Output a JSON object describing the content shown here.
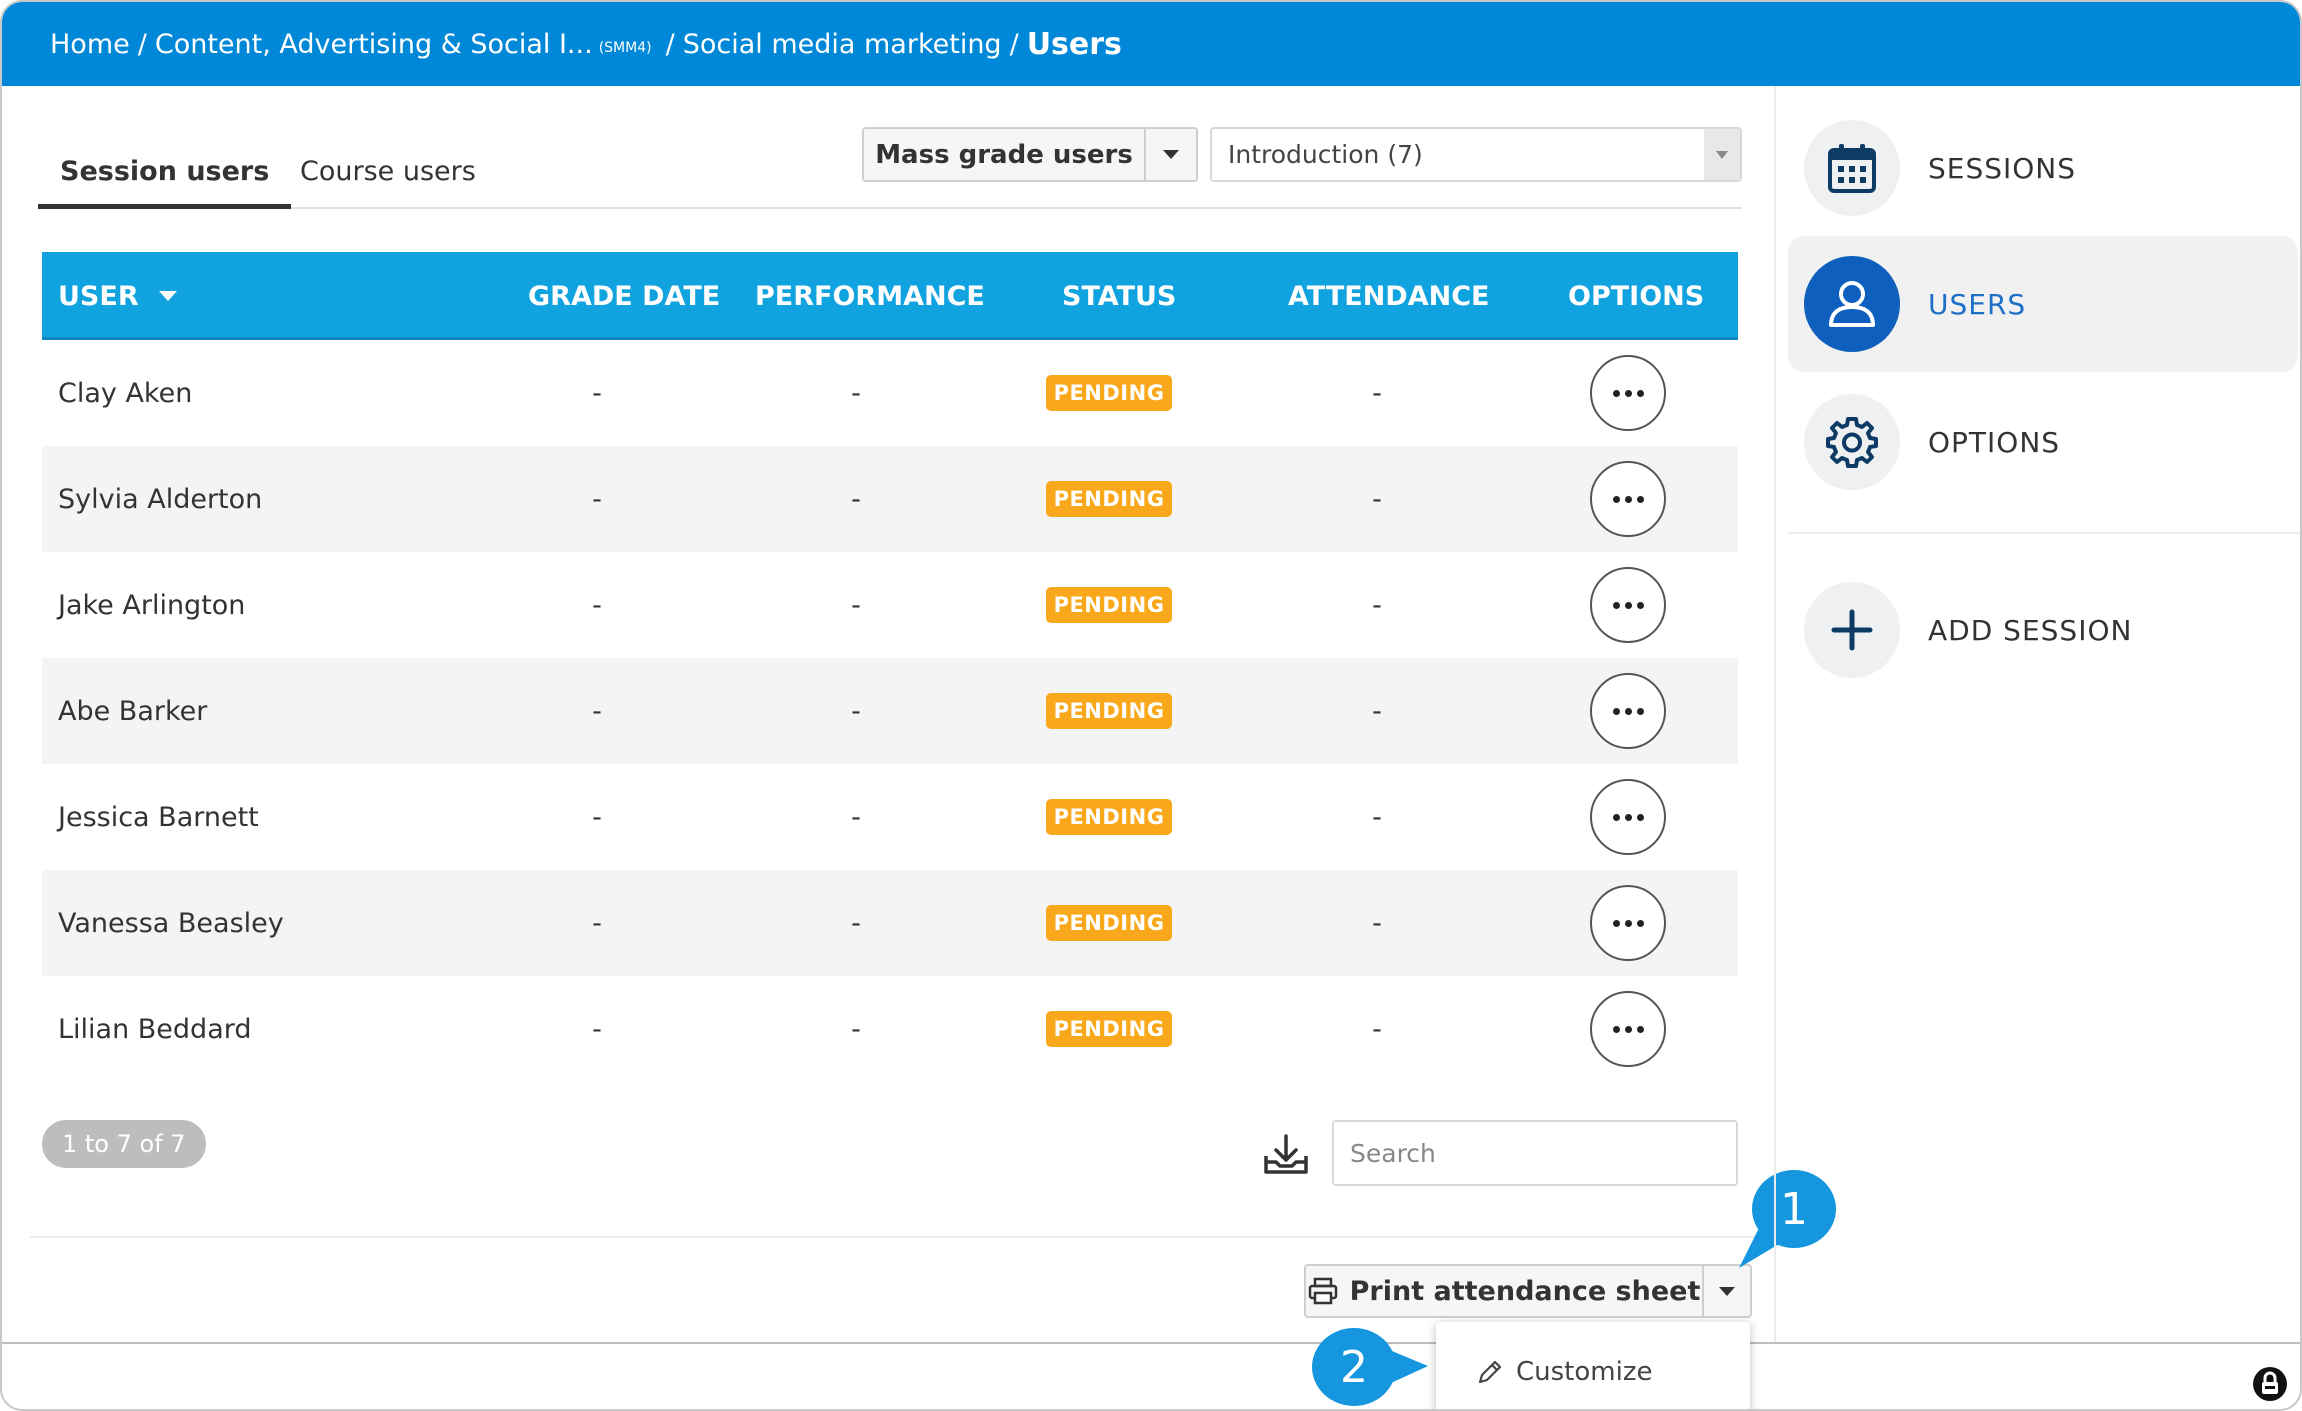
{
  "breadcrumb": {
    "home": "Home",
    "course": "Content, Advertising & Social I...",
    "course_code": "(SMM4)",
    "section": "Social media marketing",
    "current": "Users",
    "separator": "/"
  },
  "tabs": [
    {
      "label": "Session users",
      "active": true
    },
    {
      "label": "Course users",
      "active": false
    }
  ],
  "mass_grade": {
    "label": "Mass grade users"
  },
  "session_select": {
    "value": "Introduction (7)"
  },
  "table": {
    "headers": {
      "user": "USER",
      "grade_date": "GRADE DATE",
      "performance": "PERFORMANCE",
      "status": "STATUS",
      "attendance": "ATTENDANCE",
      "options": "OPTIONS"
    },
    "rows": [
      {
        "user": "Clay Aken",
        "grade_date": "-",
        "performance": "-",
        "status": "PENDING",
        "attendance": "-"
      },
      {
        "user": "Sylvia Alderton",
        "grade_date": "-",
        "performance": "-",
        "status": "PENDING",
        "attendance": "-"
      },
      {
        "user": "Jake Arlington",
        "grade_date": "-",
        "performance": "-",
        "status": "PENDING",
        "attendance": "-"
      },
      {
        "user": "Abe Barker",
        "grade_date": "-",
        "performance": "-",
        "status": "PENDING",
        "attendance": "-"
      },
      {
        "user": "Jessica Barnett",
        "grade_date": "-",
        "performance": "-",
        "status": "PENDING",
        "attendance": "-"
      },
      {
        "user": "Vanessa Beasley",
        "grade_date": "-",
        "performance": "-",
        "status": "PENDING",
        "attendance": "-"
      },
      {
        "user": "Lilian Beddard",
        "grade_date": "-",
        "performance": "-",
        "status": "PENDING",
        "attendance": "-"
      }
    ]
  },
  "pagination": {
    "text": "1 to 7 of 7"
  },
  "search": {
    "placeholder": "Search"
  },
  "print": {
    "label": "Print attendance sheet"
  },
  "dropdown": {
    "customize": "Customize"
  },
  "callouts": {
    "one": "1",
    "two": "2"
  },
  "sidebar": {
    "items": [
      {
        "label": "SESSIONS",
        "icon": "calendar-icon"
      },
      {
        "label": "USERS",
        "icon": "user-icon",
        "active": true
      },
      {
        "label": "OPTIONS",
        "icon": "gear-icon"
      },
      {
        "label": "ADD SESSION",
        "icon": "plus-icon"
      }
    ]
  },
  "colors": {
    "header_bar": "#0088d8",
    "table_header": "#10a3e0",
    "pending_badge": "#f9a81b",
    "active_sidebar_circle": "#0f5fbf",
    "callout": "#1596de"
  }
}
